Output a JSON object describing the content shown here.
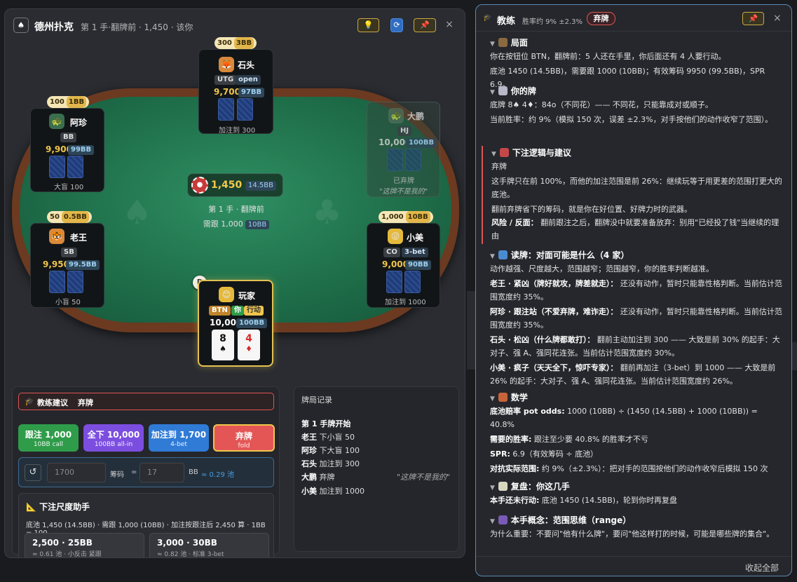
{
  "game": {
    "logo": "♠",
    "title": "德州扑克",
    "subtitle": "第 1 手·翻牌前 · 1,450 · 该你",
    "icons": {
      "tip": "lightbulb-icon",
      "refresh": "refresh-icon",
      "pin": "pin-icon",
      "close": "close-icon"
    },
    "close_label": "×"
  },
  "table": {
    "pot": "1,450",
    "pot_bb": "14.5BB",
    "hand_label": "第 1 手 · 翻牌前",
    "to_call_label": "需跟 1,000",
    "to_call_bb": "10BB",
    "dealer": "D"
  },
  "seats": {
    "shitou": {
      "name": "石头",
      "pos": "UTG",
      "action": "open",
      "chips": "9,700",
      "bb": "97BB",
      "foot": "加注到 300",
      "bet": "300",
      "bet_bb": "3BB"
    },
    "azhen": {
      "name": "阿珍",
      "pos": "BB",
      "chips": "9,900",
      "bb": "99BB",
      "foot": "大盲 100",
      "bet": "100",
      "bet_bb": "1BB"
    },
    "dapeng": {
      "name": "大鹏",
      "pos": "HJ",
      "chips": "10,000",
      "bb": "100BB",
      "foot": "已弃牌",
      "quote": "\"这牌不是我的\""
    },
    "laowang": {
      "name": "老王",
      "pos": "SB",
      "chips": "9,950",
      "bb": "99.5BB",
      "foot": "小盲 50",
      "bet": "50",
      "bet_bb": "0.5BB"
    },
    "xiaomei": {
      "name": "小美",
      "pos": "CO",
      "action": "3-bet",
      "chips": "9,000",
      "bb": "90BB",
      "foot": "加注到 1000",
      "bet": "1,000",
      "bet_bb": "10BB"
    },
    "hero": {
      "name": "玩家",
      "pos": "BTN",
      "tag": "你",
      "status": "行动",
      "chips": "10,000",
      "bb": "100BB",
      "cards": [
        {
          "rank": "8",
          "suit": "♠",
          "color": "#111111"
        },
        {
          "rank": "4",
          "suit": "♦",
          "color": "#d62a2a"
        }
      ]
    }
  },
  "coach_panel": {
    "advice_label": "教练建议",
    "advice_action": "弃牌",
    "actions": [
      {
        "main": "跟注 1,000",
        "sub": "10BB call"
      },
      {
        "main": "全下 10,000",
        "sub": "100BB all-in"
      },
      {
        "main": "加注到 1,700",
        "sub": "4-bet"
      },
      {
        "main": "弃牌",
        "sub": "fold"
      }
    ],
    "raise": {
      "reset": "↺",
      "amount_placeholder": "1700",
      "chips_label": "筹码",
      "eq": "=",
      "bb_placeholder": "17",
      "bb_label": "BB",
      "pot_ratio": "≈ 0.29 池"
    },
    "sizer": {
      "title": "下注尺度助手",
      "desc": "底池 1,450 (14.5BB) · 需跟 1,000 (10BB) · 加注按跟注后 2,450 算 · 1BB = 100",
      "options": [
        {
          "main": "2,500 · 25BB",
          "sub": "≈ 0.61 池 · 小反击 紧跟"
        },
        {
          "main": "3,000 · 30BB",
          "sub": "≈ 0.82 池 · 标准 3-bet"
        }
      ]
    }
  },
  "log": {
    "title": "牌局记录",
    "lines": [
      {
        "who": "",
        "text": "第 1 手牌开始",
        "quote": ""
      },
      {
        "who": "老王",
        "text": "下小盲 50",
        "quote": ""
      },
      {
        "who": "阿珍",
        "text": "下大盲 100",
        "quote": ""
      },
      {
        "who": "石头",
        "text": "加注到 300",
        "quote": ""
      },
      {
        "who": "大鹏",
        "text": "弃牌",
        "quote": "\"这牌不是我的\""
      },
      {
        "who": "小美",
        "text": "加注到 1000",
        "quote": ""
      }
    ]
  },
  "coach": {
    "title": "教练",
    "sub": "胜率约 9% ±2.3%",
    "badge": "弃牌",
    "footer": "收起全部",
    "sections": {
      "situation": {
        "title": "局面",
        "lines": [
          "你在按钮位 BTN，翻牌前：5 人还在手里，你后面还有 4 人要行动。",
          "底池 1450 (14.5BB)，需要跟 1000 (10BB)；有效筹码 9950 (99.5BB)，SPR 6.9。"
        ]
      },
      "hand": {
        "title": "你的牌",
        "lines": [
          "底牌 8♠ 4♦：84o（不同花）—— 不同花，只能靠成对或顺子。",
          "当前胜率：约 9%（模拟 150 次，误差 ±2.3%，对手按他们的动作收窄了范围）。"
        ]
      },
      "logic": {
        "title": "下注逻辑与建议",
        "lines": [
          "弃牌",
          "这手牌只在前 100%，而他的加注范围是前 26%：继续玩等于用更差的范围打更大的底池。",
          "翻前弃牌省下的筹码，就是你在好位置、好牌力时的武器。"
        ],
        "risk_label": "风险 / 反面：",
        "risk": "翻前跟注之后，翻牌没中就要准备放弃：别用\"已经投了钱\"当继续的理由"
      },
      "reads": {
        "title": "读牌：对面可能是什么（4 家）",
        "intro": "动作越强、尺度越大，范围越窄；范围越窄，你的胜率判断越准。",
        "items": [
          {
            "label": "老王 · 紧凶（牌好就攻，牌差就走）：",
            "text": "还没有动作，暂时只能靠性格判断。当前估计范围宽度约 35%。"
          },
          {
            "label": "阿珍 · 跟注站（不爱弃牌，难诈走）：",
            "text": "还没有动作，暂时只能靠性格判断。当前估计范围宽度约 35%。"
          },
          {
            "label": "石头 · 松凶（什么牌都敢打）：",
            "text": "翻前主动加注到 300 —— 大致是前 30% 的起手：大对子、强 A、强同花连张。当前估计范围宽度约 30%。"
          },
          {
            "label": "小美 · 疯子（天天全下，惊吓专家）：",
            "text": "翻前再加注（3-bet）到 1000 —— 大致是前 26% 的起手：大对子、强 A、强同花连张。当前估计范围宽度约 26%。"
          }
        ]
      },
      "math": {
        "title": "数学",
        "items": [
          {
            "label": "底池赔率 pot odds:",
            "text": "1000 (10BB) ÷ (1450 (14.5BB) + 1000 (10BB)) = 40.8%"
          },
          {
            "label": "需要的胜率:",
            "text": "跟注至少要 40.8% 的胜率才不亏"
          },
          {
            "label": "SPR:",
            "text": "6.9（有效筹码 ÷ 底池）"
          },
          {
            "label": "对抗实际范围:",
            "text": "约 9%（±2.3%）：把对手的范围按他们的动作收窄后模拟 150 次"
          }
        ]
      },
      "review": {
        "title": "复盘：你这几手",
        "label": "本手还未行动:",
        "text": "底池 1450 (14.5BB)，轮到你时再复盘"
      },
      "concept": {
        "title": "本手概念：范围思维（range）",
        "text": "为什么重要：不要问\"他有什么牌\"，要问\"他这样打的时候，可能是哪些牌的集合\"。"
      }
    }
  }
}
